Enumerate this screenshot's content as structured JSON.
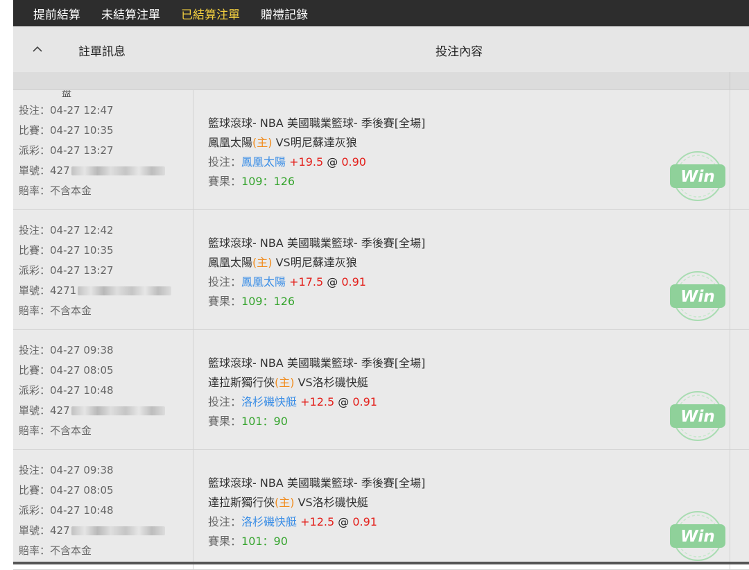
{
  "tabs": [
    {
      "label": "提前結算",
      "active": false
    },
    {
      "label": "未結算注單",
      "active": false
    },
    {
      "label": "已結算注單",
      "active": true
    },
    {
      "label": "贈禮記錄",
      "active": false
    }
  ],
  "header": {
    "info_label": "註單訊息",
    "content_label": "投注內容",
    "clipped_text": "盘"
  },
  "colors": {
    "nav_bg": "#2d2d2d",
    "active_tab": "#f4d03f",
    "home_tag": "#f08c1e",
    "team_link": "#3b8ee6",
    "odds_red": "#e3201b",
    "score_green": "#35a42d",
    "win_badge": "#8fd19a"
  },
  "bets": [
    {
      "bet_time": "投注：04-27 12:47",
      "match_time": "比賽：04-27 10:35",
      "payout_time": "派彩：04-27 13:27",
      "order_no": "單號：427",
      "odds_type": "賠率：不含本金",
      "league": "籃球滾球- NBA 美國職業籃球- 季後賽[全場]",
      "home_team": "鳳凰太陽",
      "home_tag": "(主)",
      "away_team": " VS明尼蘇達灰狼",
      "pick_label": "投注：",
      "pick_team": "鳳凰太陽",
      "handicap": " +19.5",
      "at": " @ ",
      "odds": "0.90",
      "result_label": "賽果：",
      "score": "109：126",
      "status": "Win"
    },
    {
      "bet_time": "投注：04-27 12:42",
      "match_time": "比賽：04-27 10:35",
      "payout_time": "派彩：04-27 13:27",
      "order_no": "單號：4271",
      "odds_type": "賠率：不含本金",
      "league": "籃球滾球- NBA 美國職業籃球- 季後賽[全場]",
      "home_team": "鳳凰太陽",
      "home_tag": "(主)",
      "away_team": " VS明尼蘇達灰狼",
      "pick_label": "投注：",
      "pick_team": "鳳凰太陽",
      "handicap": " +17.5",
      "at": " @ ",
      "odds": "0.91",
      "result_label": "賽果：",
      "score": "109：126",
      "status": "Win"
    },
    {
      "bet_time": "投注：04-27 09:38",
      "match_time": "比賽：04-27 08:05",
      "payout_time": "派彩：04-27 10:48",
      "order_no": "單號：427",
      "odds_type": "賠率：不含本金",
      "league": "籃球滾球- NBA 美國職業籃球- 季後賽[全場]",
      "home_team": "達拉斯獨行俠",
      "home_tag": "(主)",
      "away_team": " VS洛杉磯快艇",
      "pick_label": "投注：",
      "pick_team": "洛杉磯快艇",
      "handicap": " +12.5",
      "at": " @ ",
      "odds": "0.91",
      "result_label": "賽果：",
      "score": "101：90",
      "status": "Win"
    },
    {
      "bet_time": "投注：04-27 09:38",
      "match_time": "比賽：04-27 08:05",
      "payout_time": "派彩：04-27 10:48",
      "order_no": "單號：427",
      "odds_type": "賠率：不含本金",
      "league": "籃球滾球- NBA 美國職業籃球- 季後賽[全場]",
      "home_team": "達拉斯獨行俠",
      "home_tag": "(主)",
      "away_team": " VS洛杉磯快艇",
      "pick_label": "投注：",
      "pick_team": "洛杉磯快艇",
      "handicap": " +12.5",
      "at": " @ ",
      "odds": "0.91",
      "result_label": "賽果：",
      "score": "101：90",
      "status": "Win"
    }
  ]
}
